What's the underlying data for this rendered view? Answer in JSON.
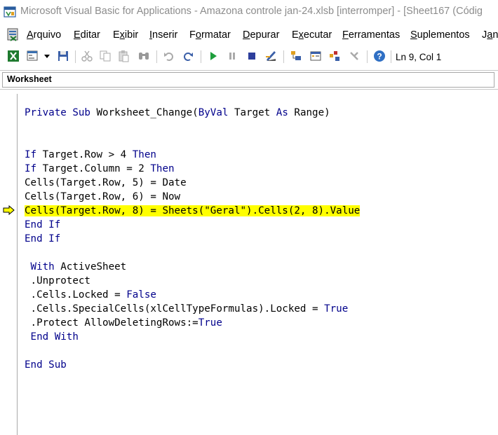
{
  "window": {
    "title": "Microsoft Visual Basic for Applications - Amazona controle jan-24.xlsb [interromper] - [Sheet167 (Códig"
  },
  "menu": {
    "items": [
      {
        "u": "A",
        "rest": "rquivo"
      },
      {
        "u": "E",
        "rest": "ditar"
      },
      {
        "u": "",
        "pre": "E",
        "mid": "x",
        "rest": "ibir"
      },
      {
        "u": "I",
        "rest": "nserir"
      },
      {
        "u": "",
        "pre": "F",
        "mid": "o",
        "rest": "rmatar"
      },
      {
        "u": "D",
        "rest": "epurar"
      },
      {
        "u": "",
        "pre": "E",
        "mid": "x",
        "rest": "ecutar"
      },
      {
        "u": "F",
        "rest": "erramentas"
      },
      {
        "u": "S",
        "rest": "uplementos"
      },
      {
        "u": "",
        "pre": "J",
        "mid": "a",
        "rest": "ne"
      }
    ]
  },
  "toolbar": {
    "status": "Ln 9, Col 1",
    "icons": [
      "excel-icon",
      "insert-form-icon",
      "dropdown-arrow-icon",
      "save-icon",
      "cut-icon",
      "copy-icon",
      "paste-icon",
      "find-icon",
      "undo-icon",
      "redo-icon",
      "run-icon",
      "break-icon",
      "reset-icon",
      "design-mode-icon",
      "project-explorer-icon",
      "properties-icon",
      "object-browser-icon",
      "toolbox-icon",
      "help-icon"
    ]
  },
  "object_bar": {
    "selected": "Worksheet"
  },
  "code": {
    "lines": [
      [
        [
          "kw",
          "Private Sub "
        ],
        [
          "",
          "Worksheet_Change("
        ],
        [
          "kw",
          "ByVal"
        ],
        [
          "",
          " Target "
        ],
        [
          "kw",
          "As"
        ],
        [
          "",
          " Range)"
        ]
      ],
      [],
      [],
      [
        [
          "kw",
          "If"
        ],
        [
          "",
          " Target.Row > 4 "
        ],
        [
          "kw",
          "Then"
        ]
      ],
      [
        [
          "kw",
          "If"
        ],
        [
          "",
          " Target.Column = 2 "
        ],
        [
          "kw",
          "Then"
        ]
      ],
      [
        [
          "",
          "Cells(Target.Row, 5) = Date"
        ]
      ],
      [
        [
          "",
          "Cells(Target.Row, 6) = Now"
        ]
      ],
      [
        [
          "hl",
          "Cells(Target.Row, 8) = Sheets(\"Geral\").Cells(2, 8).Value"
        ]
      ],
      [
        [
          "kw",
          "End If"
        ]
      ],
      [
        [
          "kw",
          "End If"
        ]
      ],
      [],
      [
        [
          "",
          " "
        ],
        [
          "kw",
          "With"
        ],
        [
          "",
          " ActiveSheet"
        ]
      ],
      [
        [
          "",
          " .Unprotect"
        ]
      ],
      [
        [
          "",
          " .Cells.Locked = "
        ],
        [
          "kw",
          "False"
        ]
      ],
      [
        [
          "",
          " .Cells.SpecialCells(xlCellTypeFormulas).Locked = "
        ],
        [
          "kw",
          "True"
        ]
      ],
      [
        [
          "",
          " .Protect AllowDeletingRows:="
        ],
        [
          "kw",
          "True"
        ]
      ],
      [
        [
          "",
          " "
        ],
        [
          "kw",
          "End With"
        ]
      ],
      [],
      [
        [
          "kw",
          "End Sub"
        ]
      ]
    ]
  }
}
